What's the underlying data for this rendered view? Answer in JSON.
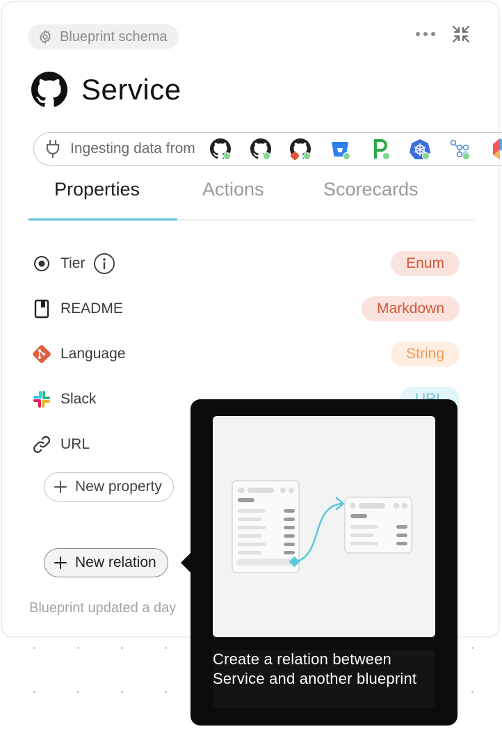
{
  "header": {
    "badge_label": "Blueprint schema",
    "badge_icon": "gear-icon",
    "more_icon": "ellipsis-icon",
    "collapse_icon": "collapse-icon"
  },
  "blueprint": {
    "title": "Service",
    "icon": "github-icon"
  },
  "ingest": {
    "label": "Ingesting data from",
    "sources": [
      {
        "icon": "github-icon",
        "status": "connected"
      },
      {
        "icon": "github-icon",
        "status": "connected"
      },
      {
        "icon": "github-git-icon",
        "status": "connected"
      },
      {
        "icon": "bitbucket-icon",
        "status": "connected"
      },
      {
        "icon": "pagerduty-icon",
        "status": "connected"
      },
      {
        "icon": "kubernetes-icon",
        "status": "connected"
      },
      {
        "icon": "argocd-icon",
        "status": "connected"
      },
      {
        "icon": "multi-color-icon",
        "status": "connected"
      }
    ],
    "status_color": "#7fd690"
  },
  "tabs": [
    {
      "label": "Properties",
      "active": true
    },
    {
      "label": "Actions",
      "active": false
    },
    {
      "label": "Scorecards",
      "active": false
    }
  ],
  "accent_color": "#5ac8da",
  "properties": [
    {
      "label": "Tier",
      "icon": "radio-target-icon",
      "type": "Enum",
      "type_color": "#d4573a",
      "type_bg": "#fbe3dd",
      "has_info": true
    },
    {
      "label": "README",
      "icon": "book-icon",
      "type": "Markdown",
      "type_color": "#d4573a",
      "type_bg": "#fbe3dd",
      "has_info": false
    },
    {
      "label": "Language",
      "icon": "git-icon",
      "type": "String",
      "type_color": "#ef9a52",
      "type_bg": "#fdeee1",
      "has_info": false
    },
    {
      "label": "Slack",
      "icon": "slack-icon",
      "type": "URL",
      "type_color": "#6cc7d4",
      "type_bg": "#e2f5f8",
      "has_info": false
    },
    {
      "label": "URL",
      "icon": "link-icon",
      "type": "",
      "type_color": "",
      "type_bg": "",
      "has_info": false
    }
  ],
  "buttons": {
    "new_property": "New property",
    "new_relation": "New relation"
  },
  "footer": {
    "text": "Blueprint updated a day"
  },
  "tooltip": {
    "text": "Create a relation between Service and another blueprint"
  }
}
